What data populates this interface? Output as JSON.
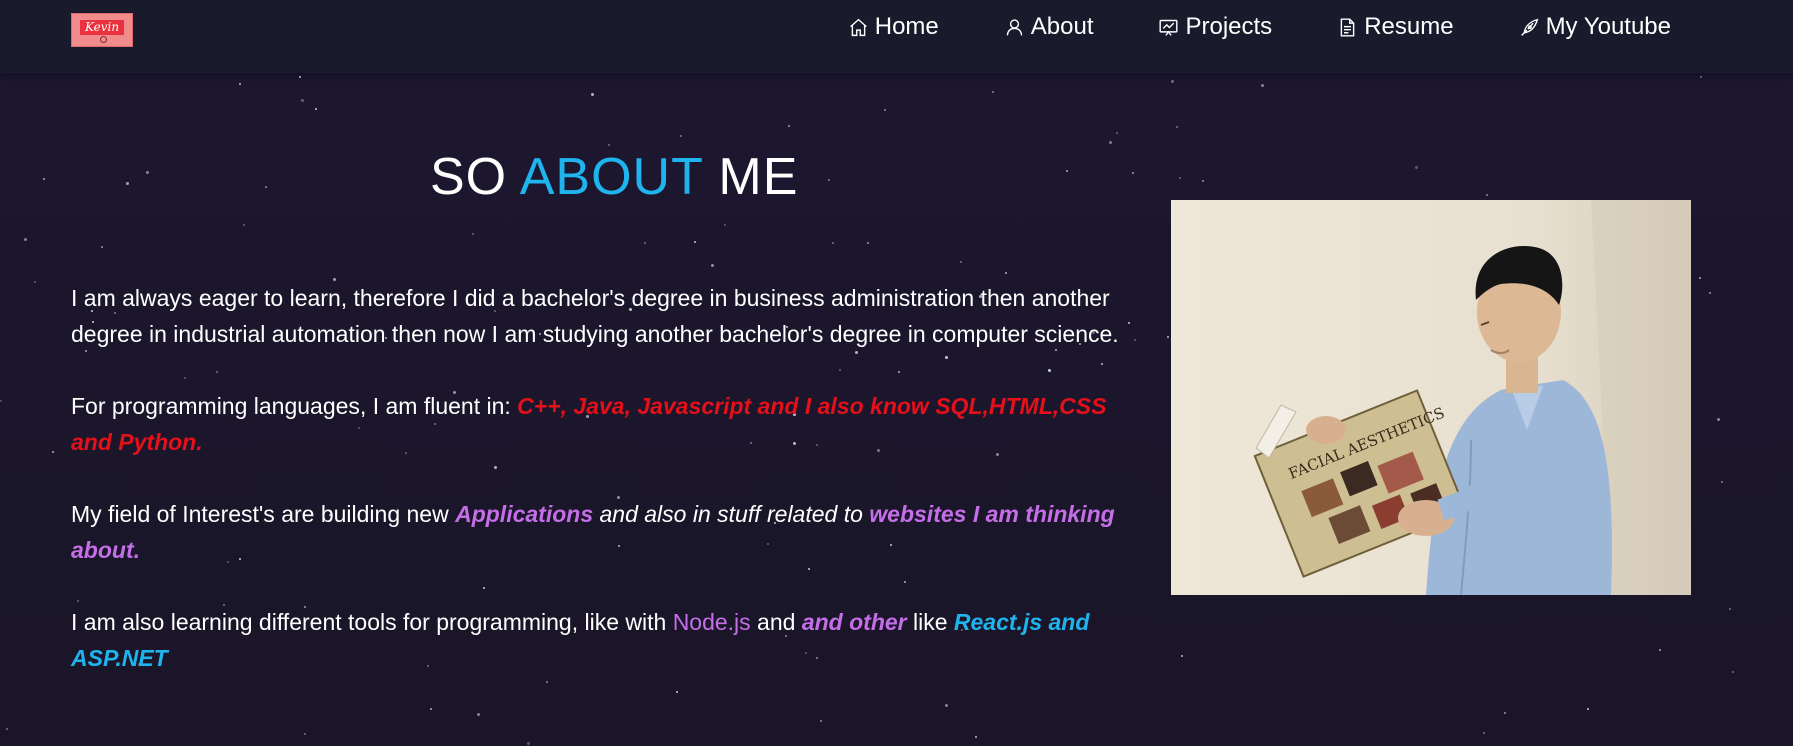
{
  "logo": {
    "text": "Kevin"
  },
  "nav": {
    "items": [
      {
        "label": "Home",
        "icon": "home-icon"
      },
      {
        "label": "About",
        "icon": "user-icon"
      },
      {
        "label": "Projects",
        "icon": "presentation-icon"
      },
      {
        "label": "Resume",
        "icon": "document-icon"
      },
      {
        "label": "My Youtube",
        "icon": "pen-nib-icon"
      }
    ]
  },
  "title": {
    "part1": "SO",
    "accent": "ABOUT",
    "part2": "ME"
  },
  "about": {
    "p1": "I am always eager to learn, therefore I did a bachelor's degree in business administration then another degree in industrial automation then now I am studying another bachelor's degree in computer science.",
    "p2_prefix": "For programming languages, I am fluent in: ",
    "p2_highlight": "C++, Java, Javascript and I also know SQL,HTML,CSS and Python.",
    "p3_prefix": "My field of Interest's are building new ",
    "p3_highlight1": "Applications",
    "p3_middle": " and also in stuff related to ",
    "p3_highlight2": "websites I am thinking about.",
    "p4_prefix": "I am also learning different tools for programming, like with ",
    "p4_highlight1": "Node.js",
    "p4_and": " and ",
    "p4_highlight2": "and other",
    "p4_like": " like ",
    "p4_highlight3": "React.js and ASP.NET"
  },
  "photo": {
    "book_title": "FACIAL AESTHETICS"
  },
  "colors": {
    "accent_blue": "#1fb4ee",
    "red": "#e4101a",
    "purple": "#c46ee8",
    "background": "#1b1629",
    "navbar": "#191a2c"
  }
}
